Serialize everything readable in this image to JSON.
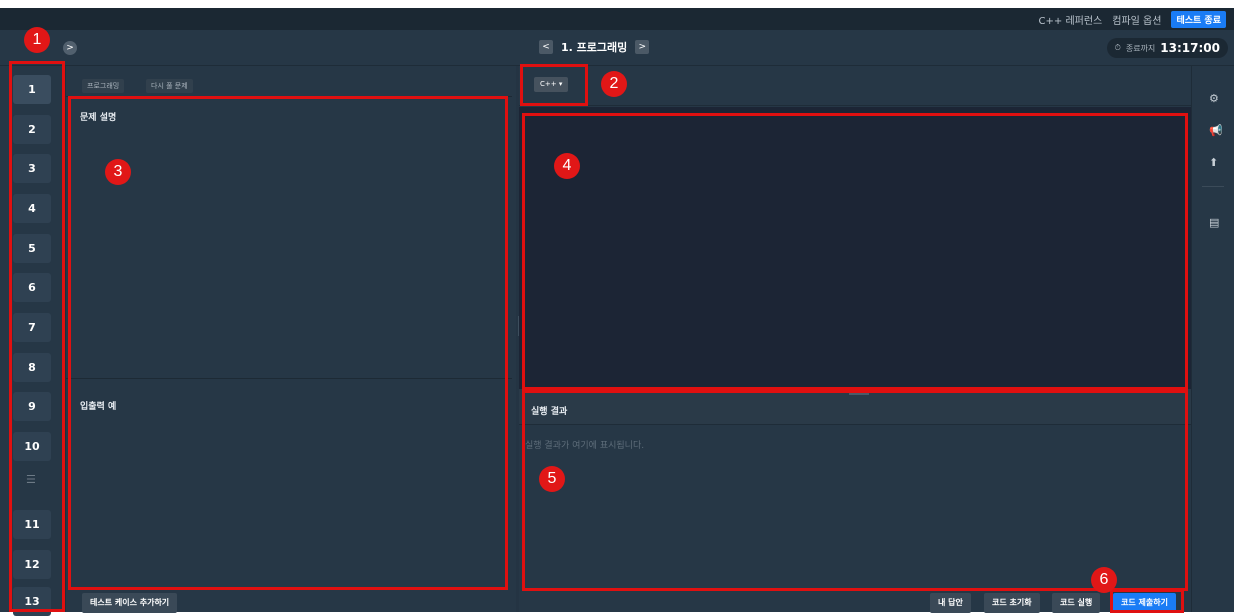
{
  "topbar": {
    "link_cpp_ref": "C++ 레퍼런스",
    "link_compile": "컴파일 옵션",
    "end_test": "테스트 종료"
  },
  "nav": {
    "prev": "<",
    "next": ">",
    "title": "1. 프로그래밍",
    "expand": ">"
  },
  "timer": {
    "label": "종료까지",
    "value": "13:17:00",
    "icon": "clock-icon"
  },
  "questions": [
    "1",
    "2",
    "3",
    "4",
    "5",
    "6",
    "7",
    "8",
    "9",
    "10",
    "11",
    "12",
    "13"
  ],
  "question_list_icon": "list-icon",
  "left_panel": {
    "chip_type": "프로그래밍",
    "chip_review": "다시 풀 문제",
    "section_desc": "문제 설명",
    "section_io": "입출력 예"
  },
  "editor": {
    "language": "C++ ▾"
  },
  "result": {
    "title": "실행 결과",
    "placeholder": "실행 결과가 여기에 표시됩니다."
  },
  "sidebar_icons": [
    "gear-icon",
    "megaphone-icon",
    "upload-icon",
    "memo-icon"
  ],
  "footer": {
    "add_testcase": "테스트 케이스 추가하기",
    "my_answer": "내 답안",
    "reset_code": "코드 초기화",
    "run_code": "코드 실행",
    "submit_code": "코드 제출하기"
  },
  "annotations": {
    "m1": "1",
    "m2": "2",
    "m3": "3",
    "m4": "4",
    "m5": "5",
    "m6": "6",
    "color": "#e01010"
  }
}
